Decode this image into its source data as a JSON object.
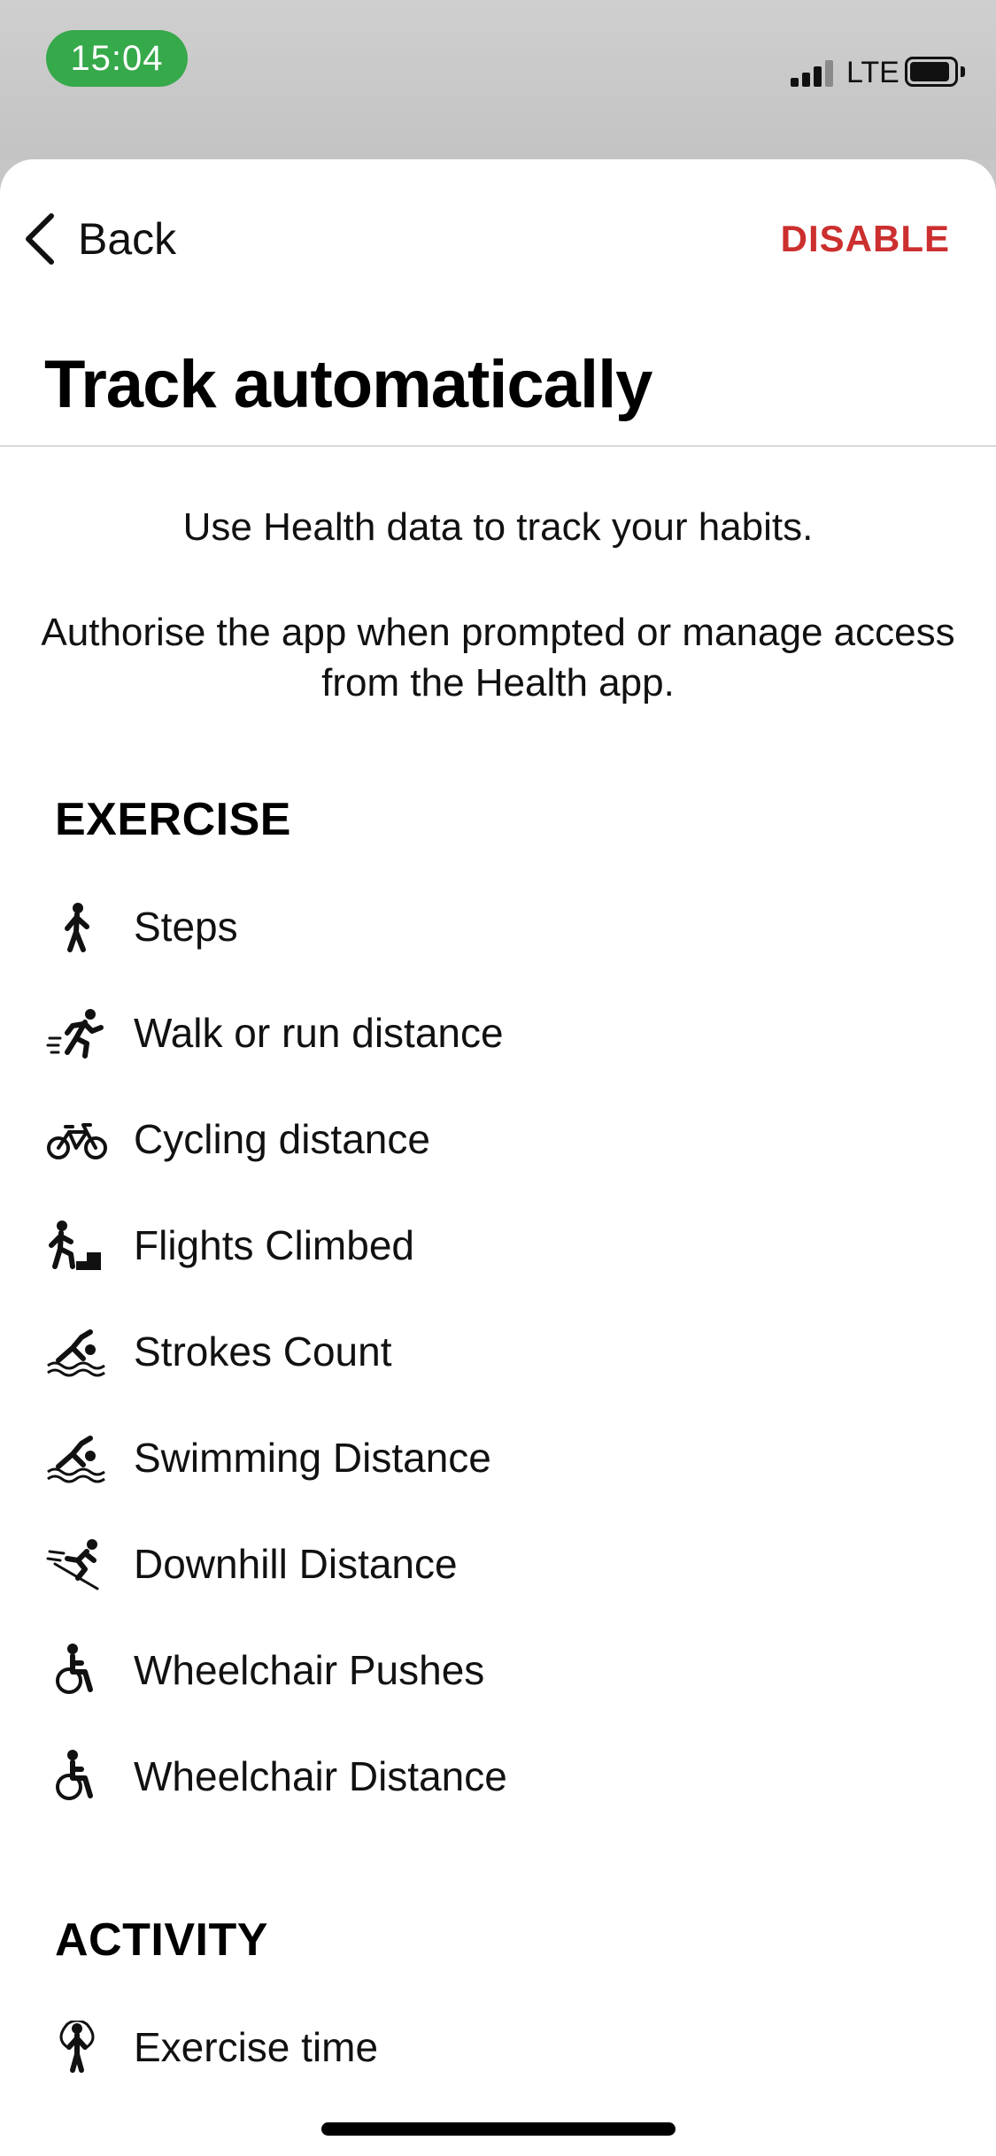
{
  "status_bar": {
    "time": "15:04",
    "network": "LTE"
  },
  "header": {
    "back_label": "Back",
    "action_label": "DISABLE",
    "title": "Track automatically"
  },
  "intro": {
    "line1": "Use Health data to track your habits.",
    "line2": "Authorise the app when prompted or manage access from the Health app."
  },
  "sections": [
    {
      "title": "EXERCISE",
      "items": [
        {
          "label": "Steps",
          "icon": "walking-figure-icon"
        },
        {
          "label": "Walk or run distance",
          "icon": "running-figure-icon"
        },
        {
          "label": "Cycling distance",
          "icon": "bicycle-icon"
        },
        {
          "label": "Flights Climbed",
          "icon": "stairs-climber-icon"
        },
        {
          "label": "Strokes Count",
          "icon": "swimmer-icon"
        },
        {
          "label": "Swimming Distance",
          "icon": "swimmer-icon"
        },
        {
          "label": "Downhill Distance",
          "icon": "skier-icon"
        },
        {
          "label": "Wheelchair Pushes",
          "icon": "wheelchair-icon"
        },
        {
          "label": "Wheelchair Distance",
          "icon": "wheelchair-icon"
        }
      ]
    },
    {
      "title": "ACTIVITY",
      "items": [
        {
          "label": "Exercise time",
          "icon": "jump-rope-icon"
        }
      ]
    }
  ],
  "colors": {
    "accent": "#cc2f2f",
    "time_pill": "#36a94a",
    "background": "#ffffff"
  }
}
